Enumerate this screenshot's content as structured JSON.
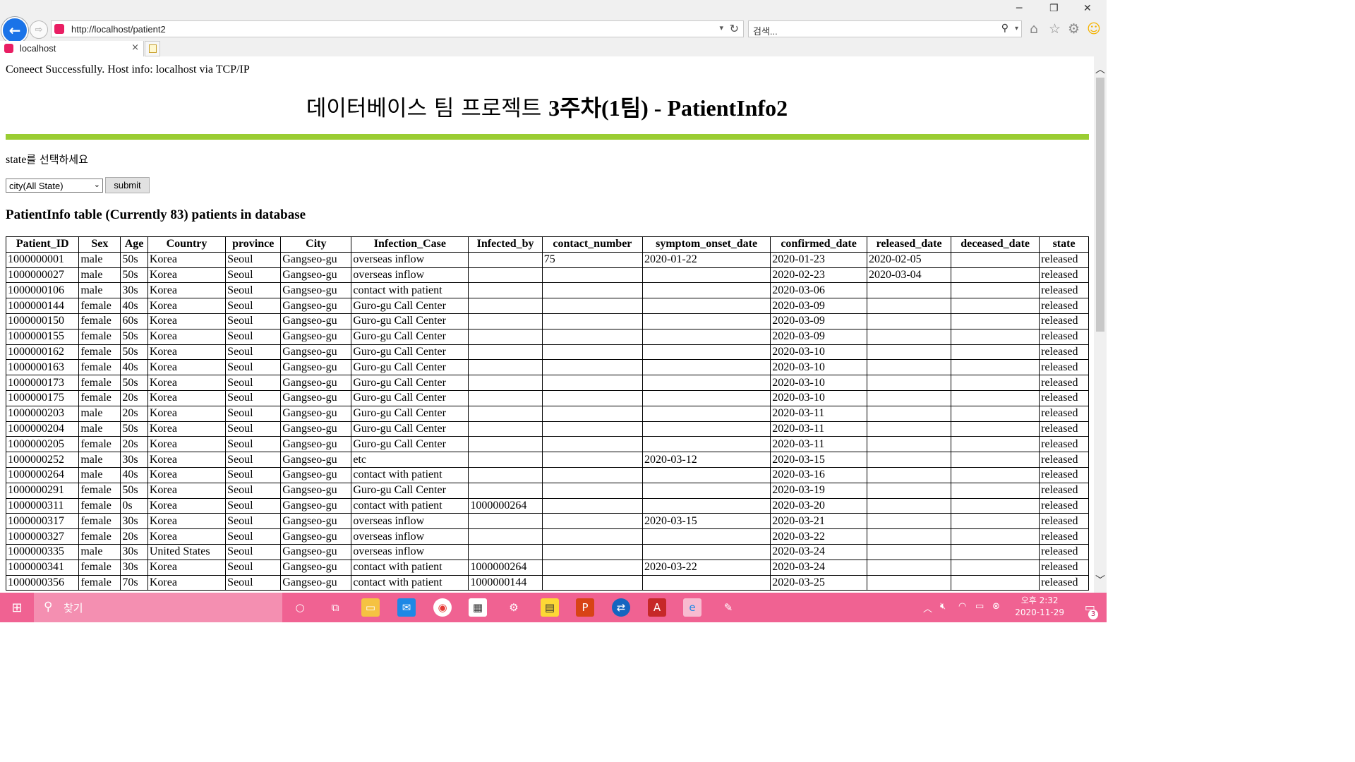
{
  "browser": {
    "window_controls": {
      "minimize": "─",
      "restore": "❐",
      "close": "✕"
    },
    "back_glyph": "←",
    "forward_glyph": "⇨",
    "url": "http://localhost/patient2",
    "refresh_glyph": "↻",
    "search_placeholder": "검색...",
    "tab_title": "localhost",
    "tab_close": "×",
    "toolbar_icons": [
      "home-icon",
      "star-icon",
      "gear-icon",
      "smiley-icon"
    ]
  },
  "page": {
    "connection_message": "Coneect Successfully. Host info: localhost via TCP/IP",
    "title_korean": "데이터베이스 팀 프로젝트 ",
    "title_rest": "3주차(1팀) - PatientInfo2",
    "state_prompt_prefix": "state",
    "state_prompt_suffix": "를 선택하세요",
    "state_select_value": "city(All State)",
    "submit_label": "submit",
    "table_heading": "PatientInfo table (Currently 83) patients in database",
    "accent_color": "#9acd32"
  },
  "table": {
    "columns": [
      "Patient_ID",
      "Sex",
      "Age",
      "Country",
      "province",
      "City",
      "Infection_Case",
      "Infected_by",
      "contact_number",
      "symptom_onset_date",
      "confirmed_date",
      "released_date",
      "deceased_date",
      "state"
    ],
    "rows": [
      [
        "1000000001",
        "male",
        "50s",
        "Korea",
        "Seoul",
        "Gangseo-gu",
        "overseas inflow",
        "",
        "75",
        "2020-01-22",
        "2020-01-23",
        "2020-02-05",
        "",
        "released"
      ],
      [
        "1000000027",
        "male",
        "50s",
        "Korea",
        "Seoul",
        "Gangseo-gu",
        "overseas inflow",
        "",
        "",
        "",
        "2020-02-23",
        "2020-03-04",
        "",
        "released"
      ],
      [
        "1000000106",
        "male",
        "30s",
        "Korea",
        "Seoul",
        "Gangseo-gu",
        "contact with patient",
        "",
        "",
        "",
        "2020-03-06",
        "",
        "",
        "released"
      ],
      [
        "1000000144",
        "female",
        "40s",
        "Korea",
        "Seoul",
        "Gangseo-gu",
        "Guro-gu Call Center",
        "",
        "",
        "",
        "2020-03-09",
        "",
        "",
        "released"
      ],
      [
        "1000000150",
        "female",
        "60s",
        "Korea",
        "Seoul",
        "Gangseo-gu",
        "Guro-gu Call Center",
        "",
        "",
        "",
        "2020-03-09",
        "",
        "",
        "released"
      ],
      [
        "1000000155",
        "female",
        "50s",
        "Korea",
        "Seoul",
        "Gangseo-gu",
        "Guro-gu Call Center",
        "",
        "",
        "",
        "2020-03-09",
        "",
        "",
        "released"
      ],
      [
        "1000000162",
        "female",
        "50s",
        "Korea",
        "Seoul",
        "Gangseo-gu",
        "Guro-gu Call Center",
        "",
        "",
        "",
        "2020-03-10",
        "",
        "",
        "released"
      ],
      [
        "1000000163",
        "female",
        "40s",
        "Korea",
        "Seoul",
        "Gangseo-gu",
        "Guro-gu Call Center",
        "",
        "",
        "",
        "2020-03-10",
        "",
        "",
        "released"
      ],
      [
        "1000000173",
        "female",
        "50s",
        "Korea",
        "Seoul",
        "Gangseo-gu",
        "Guro-gu Call Center",
        "",
        "",
        "",
        "2020-03-10",
        "",
        "",
        "released"
      ],
      [
        "1000000175",
        "female",
        "20s",
        "Korea",
        "Seoul",
        "Gangseo-gu",
        "Guro-gu Call Center",
        "",
        "",
        "",
        "2020-03-10",
        "",
        "",
        "released"
      ],
      [
        "1000000203",
        "male",
        "20s",
        "Korea",
        "Seoul",
        "Gangseo-gu",
        "Guro-gu Call Center",
        "",
        "",
        "",
        "2020-03-11",
        "",
        "",
        "released"
      ],
      [
        "1000000204",
        "male",
        "50s",
        "Korea",
        "Seoul",
        "Gangseo-gu",
        "Guro-gu Call Center",
        "",
        "",
        "",
        "2020-03-11",
        "",
        "",
        "released"
      ],
      [
        "1000000205",
        "female",
        "20s",
        "Korea",
        "Seoul",
        "Gangseo-gu",
        "Guro-gu Call Center",
        "",
        "",
        "",
        "2020-03-11",
        "",
        "",
        "released"
      ],
      [
        "1000000252",
        "male",
        "30s",
        "Korea",
        "Seoul",
        "Gangseo-gu",
        "etc",
        "",
        "",
        "2020-03-12",
        "2020-03-15",
        "",
        "",
        "released"
      ],
      [
        "1000000264",
        "male",
        "40s",
        "Korea",
        "Seoul",
        "Gangseo-gu",
        "contact with patient",
        "",
        "",
        "",
        "2020-03-16",
        "",
        "",
        "released"
      ],
      [
        "1000000291",
        "female",
        "50s",
        "Korea",
        "Seoul",
        "Gangseo-gu",
        "Guro-gu Call Center",
        "",
        "",
        "",
        "2020-03-19",
        "",
        "",
        "released"
      ],
      [
        "1000000311",
        "female",
        "0s",
        "Korea",
        "Seoul",
        "Gangseo-gu",
        "contact with patient",
        "1000000264",
        "",
        "",
        "2020-03-20",
        "",
        "",
        "released"
      ],
      [
        "1000000317",
        "female",
        "30s",
        "Korea",
        "Seoul",
        "Gangseo-gu",
        "overseas inflow",
        "",
        "",
        "2020-03-15",
        "2020-03-21",
        "",
        "",
        "released"
      ],
      [
        "1000000327",
        "female",
        "20s",
        "Korea",
        "Seoul",
        "Gangseo-gu",
        "overseas inflow",
        "",
        "",
        "",
        "2020-03-22",
        "",
        "",
        "released"
      ],
      [
        "1000000335",
        "male",
        "30s",
        "United States",
        "Seoul",
        "Gangseo-gu",
        "overseas inflow",
        "",
        "",
        "",
        "2020-03-24",
        "",
        "",
        "released"
      ],
      [
        "1000000341",
        "female",
        "30s",
        "Korea",
        "Seoul",
        "Gangseo-gu",
        "contact with patient",
        "1000000264",
        "",
        "2020-03-22",
        "2020-03-24",
        "",
        "",
        "released"
      ],
      [
        "1000000356",
        "female",
        "70s",
        "Korea",
        "Seoul",
        "Gangseo-gu",
        "contact with patient",
        "1000000144",
        "",
        "",
        "2020-03-25",
        "",
        "",
        "released"
      ]
    ]
  },
  "taskbar": {
    "search_text": "찾기",
    "apps": [
      "cortana-icon",
      "task-view-icon",
      "file-explorer-icon",
      "mail-icon",
      "chrome-icon",
      "store-icon",
      "settings-icon",
      "sticky-notes-icon",
      "powerpoint-icon",
      "teamviewer-icon",
      "acrobat-icon",
      "internet-explorer-icon",
      "paint-icon"
    ],
    "clock_ampm_time": "오후 2:32",
    "clock_date": "2020-11-29",
    "notification_count": "3",
    "color": "#f06292"
  }
}
